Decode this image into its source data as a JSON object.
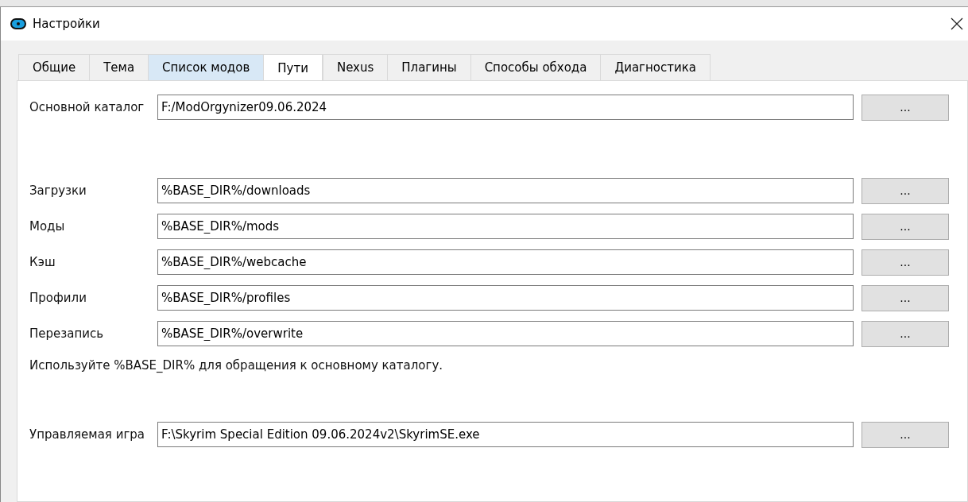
{
  "window": {
    "title": "Настройки"
  },
  "tabs": [
    {
      "label": "Общие",
      "selected": false,
      "hovered": false
    },
    {
      "label": "Тема",
      "selected": false,
      "hovered": false
    },
    {
      "label": "Список модов",
      "selected": false,
      "hovered": true
    },
    {
      "label": "Пути",
      "selected": true,
      "hovered": false
    },
    {
      "label": "Nexus",
      "selected": false,
      "hovered": false
    },
    {
      "label": "Плагины",
      "selected": false,
      "hovered": false
    },
    {
      "label": "Способы обхода",
      "selected": false,
      "hovered": false
    },
    {
      "label": "Диагностика",
      "selected": false,
      "hovered": false
    }
  ],
  "base_dir": {
    "label": "Основной каталог",
    "value": "F:/ModOrgynizer09.06.2024",
    "button": "..."
  },
  "paths": [
    {
      "label": "Загрузки",
      "value": "%BASE_DIR%/downloads",
      "button": "..."
    },
    {
      "label": "Моды",
      "value": "%BASE_DIR%/mods",
      "button": "..."
    },
    {
      "label": "Кэш",
      "value": "%BASE_DIR%/webcache",
      "button": "..."
    },
    {
      "label": "Профили",
      "value": "%BASE_DIR%/profiles",
      "button": "..."
    },
    {
      "label": "Перезапись",
      "value": "%BASE_DIR%/overwrite",
      "button": "..."
    }
  ],
  "hint": "Используйте %BASE_DIR% для обращения к основному каталогу.",
  "managed_game": {
    "label": "Управляемая игра",
    "value": "F:\\Skyrim Special Edition 09.06.2024v2\\SkyrimSE.exe",
    "button": "..."
  }
}
